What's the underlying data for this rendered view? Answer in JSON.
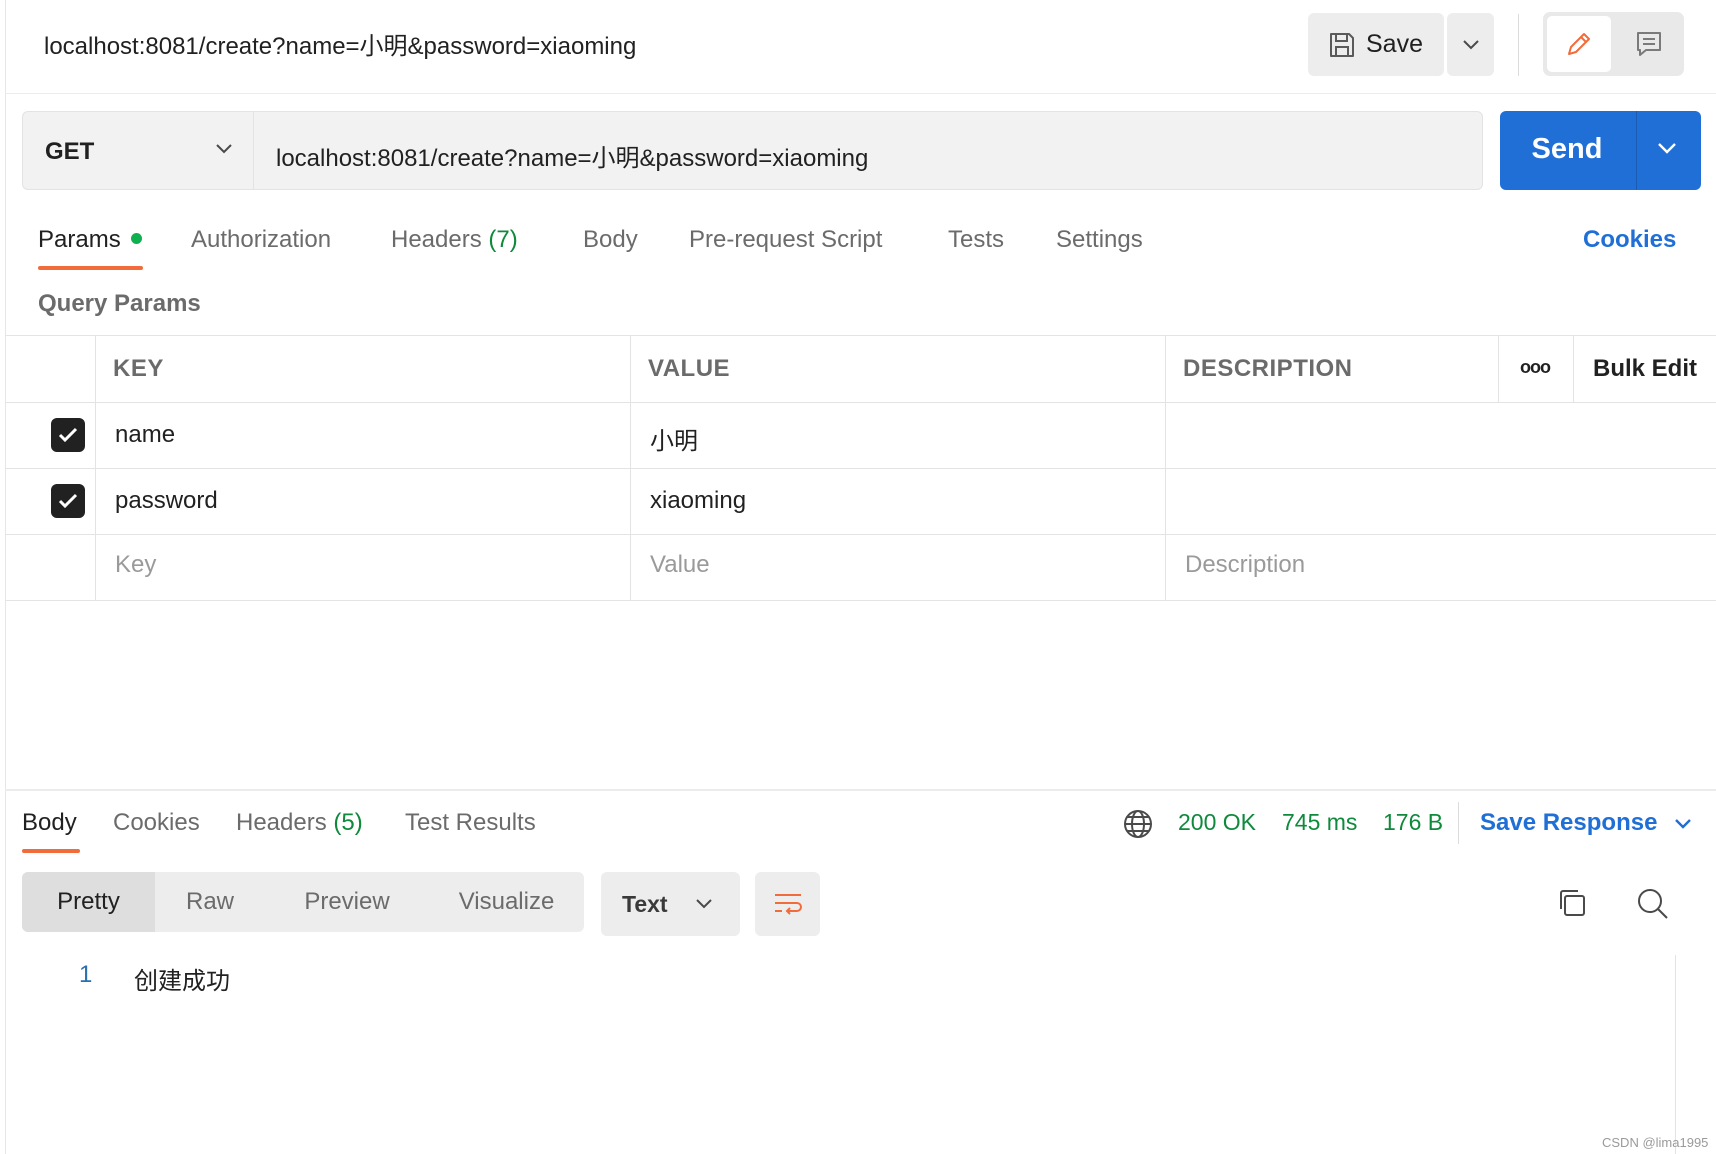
{
  "header": {
    "title": "localhost:8081/create?name=小明&password=xiaoming",
    "save_label": "Save"
  },
  "request": {
    "method": "GET",
    "url": "localhost:8081/create?name=小明&password=xiaoming",
    "send_label": "Send"
  },
  "tabs": {
    "params": "Params",
    "authorization": "Authorization",
    "headers": "Headers",
    "headers_count": "(7)",
    "body": "Body",
    "prerequest": "Pre-request Script",
    "tests": "Tests",
    "settings": "Settings",
    "cookies": "Cookies"
  },
  "query_params": {
    "title": "Query Params",
    "columns": {
      "key": "KEY",
      "value": "VALUE",
      "description": "DESCRIPTION"
    },
    "more_label": "ooo",
    "bulk_edit": "Bulk Edit",
    "rows": [
      {
        "key": "name",
        "value": "小明",
        "description": ""
      },
      {
        "key": "password",
        "value": "xiaoming",
        "description": ""
      }
    ],
    "placeholder": {
      "key": "Key",
      "value": "Value",
      "description": "Description"
    }
  },
  "response": {
    "tabs": {
      "body": "Body",
      "cookies": "Cookies",
      "headers": "Headers",
      "headers_count": "(5)",
      "test_results": "Test Results"
    },
    "status": "200 OK",
    "time": "745 ms",
    "size": "176 B",
    "save_response": "Save Response",
    "view_modes": [
      "Pretty",
      "Raw",
      "Preview",
      "Visualize"
    ],
    "format": "Text",
    "lines": [
      {
        "number": "1",
        "text": "创建成功"
      }
    ]
  },
  "watermark": "CSDN @lima1995",
  "colors": {
    "accent": "#1f6fd6",
    "active_underline": "#f26b3a",
    "success": "#0f8a3c"
  }
}
